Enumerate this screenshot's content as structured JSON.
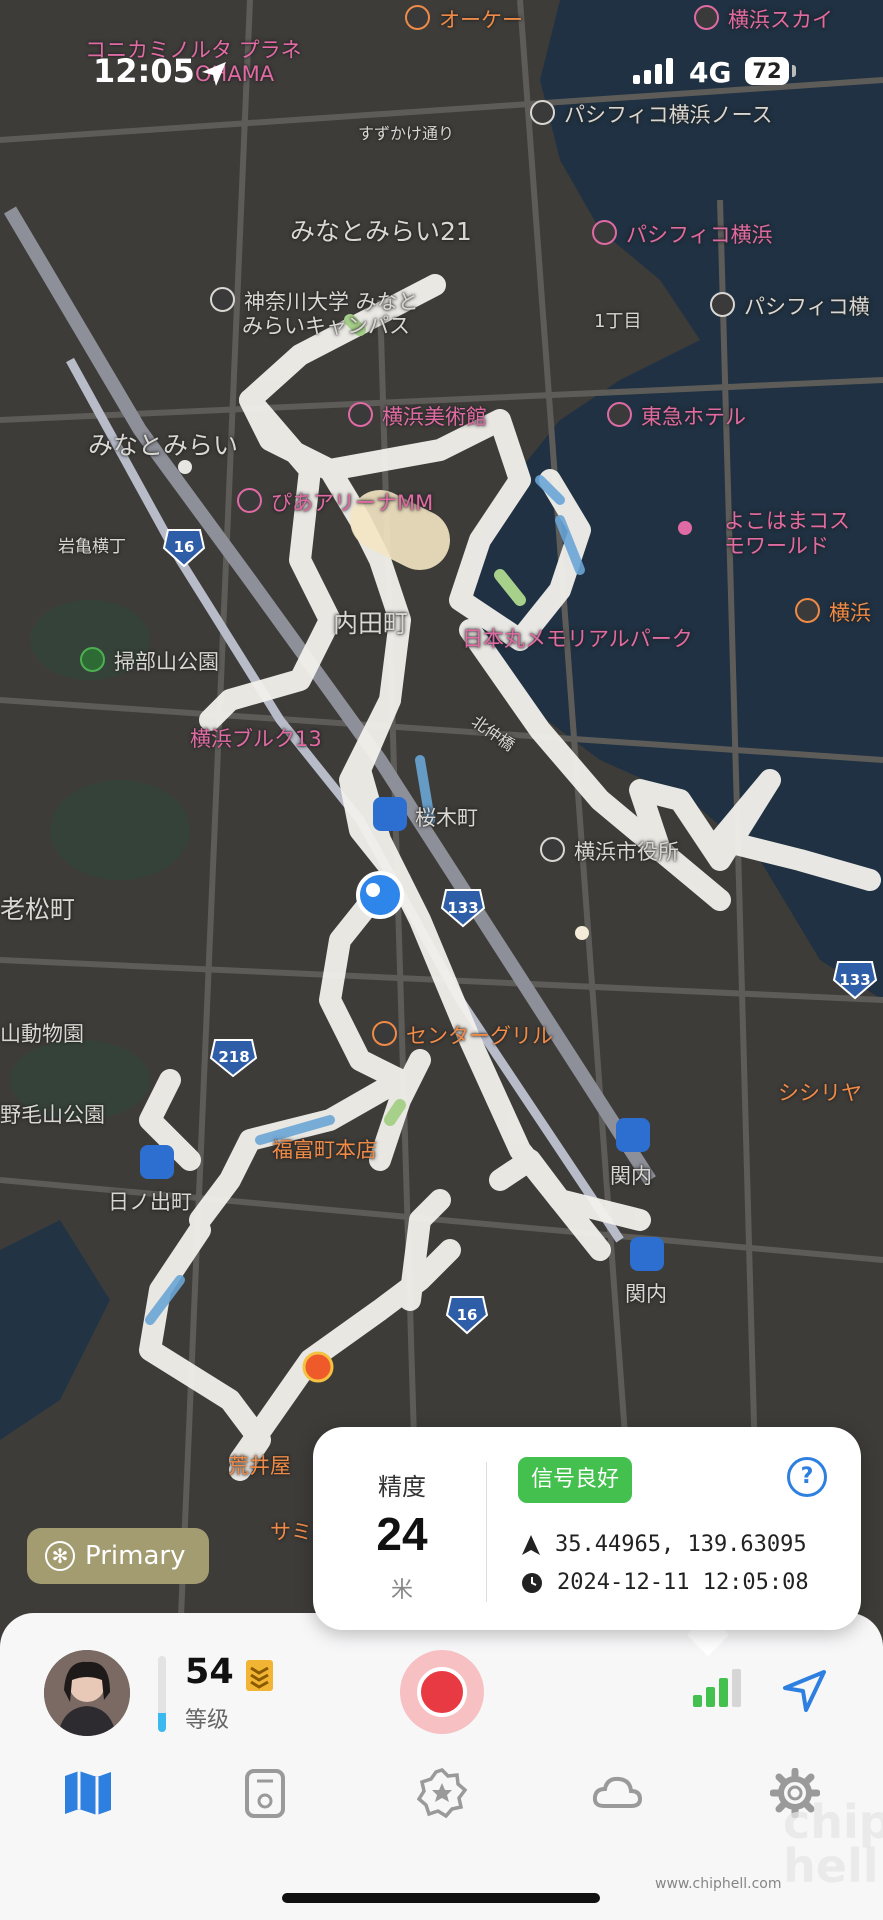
{
  "status_bar": {
    "time": "12:05",
    "network": "4G",
    "battery": "72"
  },
  "map": {
    "labels": [
      {
        "id": "l1",
        "text": "オーケー",
        "cls": "orange poi"
      },
      {
        "id": "l2",
        "text": "横浜スカイ",
        "cls": "pink poi"
      },
      {
        "id": "l3",
        "text": "コニカミノルタ プラネ",
        "cls": ""
      },
      {
        "id": "l4",
        "text": "OHAMA",
        "cls": ""
      },
      {
        "id": "l5",
        "text": "すずかけ通り",
        "cls": ""
      },
      {
        "id": "l6",
        "text": "パシフィコ横浜ノース",
        "cls": "poi"
      },
      {
        "id": "l7",
        "text": "みなとみらい21",
        "cls": "big"
      },
      {
        "id": "l8",
        "text": "パシフィコ横浜",
        "cls": "pink poi"
      },
      {
        "id": "l9",
        "text": "神奈川大学 みなと",
        "cls": "poi"
      },
      {
        "id": "l10",
        "text": "みらいキャンパス",
        "cls": ""
      },
      {
        "id": "l11",
        "text": "パシフィコ横",
        "cls": "poi"
      },
      {
        "id": "l12",
        "text": "1丁目",
        "cls": ""
      },
      {
        "id": "l13",
        "text": "横浜美術館",
        "cls": "pink poi"
      },
      {
        "id": "l14",
        "text": "東急ホテル",
        "cls": "pink poi"
      },
      {
        "id": "l15",
        "text": "みなとみらい",
        "cls": "big"
      },
      {
        "id": "l16",
        "text": "ぴあアリーナMM",
        "cls": "pink poi"
      },
      {
        "id": "l17",
        "text": "よこはまコス",
        "cls": "pink"
      },
      {
        "id": "l18",
        "text": "モワールド",
        "cls": "pink"
      },
      {
        "id": "l19",
        "text": "岩亀横丁",
        "cls": ""
      },
      {
        "id": "l20",
        "text": "横浜",
        "cls": "orange poi"
      },
      {
        "id": "l21",
        "text": "内田町",
        "cls": "big"
      },
      {
        "id": "l22",
        "text": "日本丸メモリアルパーク",
        "cls": "pink"
      },
      {
        "id": "l23",
        "text": "掃部山公園",
        "cls": "poi"
      },
      {
        "id": "l24",
        "text": "横浜ブルク13",
        "cls": "pink"
      },
      {
        "id": "l25",
        "text": "北仲橋",
        "cls": ""
      },
      {
        "id": "l26",
        "text": "桜木町",
        "cls": ""
      },
      {
        "id": "l27",
        "text": "横浜市役所",
        "cls": "poi"
      },
      {
        "id": "l28",
        "text": "老松町",
        "cls": "big"
      },
      {
        "id": "l29",
        "text": "センターグリル",
        "cls": "orange poi"
      },
      {
        "id": "l30",
        "text": "山動物園",
        "cls": ""
      },
      {
        "id": "l31",
        "text": "シシリヤ",
        "cls": "orange"
      },
      {
        "id": "l32",
        "text": "野毛山公園",
        "cls": ""
      },
      {
        "id": "l33",
        "text": "関内",
        "cls": ""
      },
      {
        "id": "l34",
        "text": "福富町本店",
        "cls": "orange"
      },
      {
        "id": "l35",
        "text": "日ノ出町",
        "cls": ""
      },
      {
        "id": "l36",
        "text": "関内",
        "cls": ""
      },
      {
        "id": "l37",
        "text": "荒井屋",
        "cls": "orange"
      },
      {
        "id": "l38",
        "text": "サミ",
        "cls": "orange"
      }
    ],
    "route_numbers": [
      "16",
      "133",
      "133",
      "218",
      "16"
    ]
  },
  "primary_badge": {
    "label": "Primary"
  },
  "accuracy_popup": {
    "label": "精度",
    "value": "24",
    "unit": "米",
    "signal_badge": "信号良好",
    "help": "?",
    "coordinates": "35.44965, 139.63095",
    "timestamp": "2024-12-11 12:05:08"
  },
  "profile": {
    "level": "54",
    "level_label": "等级",
    "level_progress": 0.25
  },
  "tabs": [
    {
      "name": "map",
      "icon": "map-icon",
      "active": true
    },
    {
      "name": "device",
      "icon": "device-icon",
      "active": false
    },
    {
      "name": "badge",
      "icon": "badge-star-icon",
      "active": false
    },
    {
      "name": "cloud",
      "icon": "cloud-icon",
      "active": false
    },
    {
      "name": "settings",
      "icon": "gear-icon",
      "active": false
    }
  ],
  "colors": {
    "accent": "#2d7fe0",
    "signal_green": "#44c04e",
    "record_red": "#e83a43",
    "map_bg": "#3d3c39"
  },
  "watermark": {
    "site": "www.chiphell.com",
    "logo": "chip hell"
  }
}
